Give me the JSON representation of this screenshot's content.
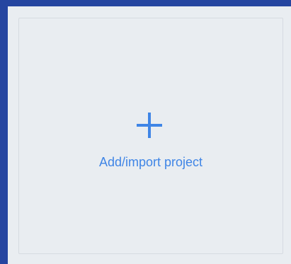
{
  "card": {
    "icon": "plus-icon",
    "label": "Add/import project"
  },
  "colors": {
    "background": "#2545a0",
    "card": "#e9edf1",
    "accent": "#3f85e6"
  }
}
